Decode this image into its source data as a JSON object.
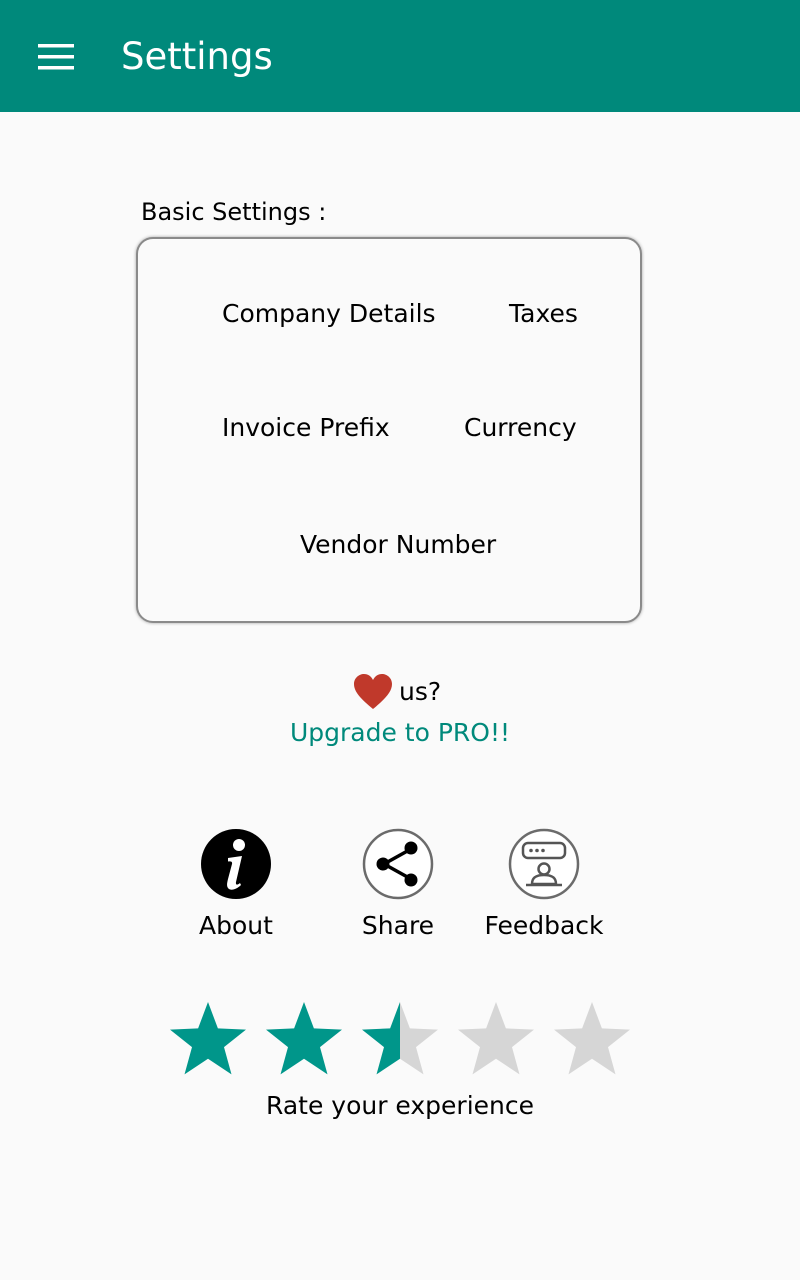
{
  "appbar": {
    "title": "Settings",
    "menu_icon": "hamburger-menu-icon",
    "color": "#00897b"
  },
  "basic_settings": {
    "label": "Basic Settings :",
    "items": {
      "company_details": "Company Details",
      "taxes": "Taxes",
      "invoice_prefix": "Invoice Prefix",
      "currency": "Currency",
      "vendor_number": "Vendor Number"
    }
  },
  "promo": {
    "heart_icon": "heart-icon",
    "heart_color": "#c0392b",
    "text": "us?",
    "upgrade_link": "Upgrade to PRO!!"
  },
  "actions": {
    "about": {
      "label": "About",
      "icon": "info-icon"
    },
    "share": {
      "label": "Share",
      "icon": "share-icon"
    },
    "feedback": {
      "label": "Feedback",
      "icon": "feedback-icon"
    }
  },
  "rating": {
    "value": 2.5,
    "max": 5,
    "filled_color": "#00968a",
    "empty_color": "#d6d6d6",
    "label": "Rate your experience"
  }
}
